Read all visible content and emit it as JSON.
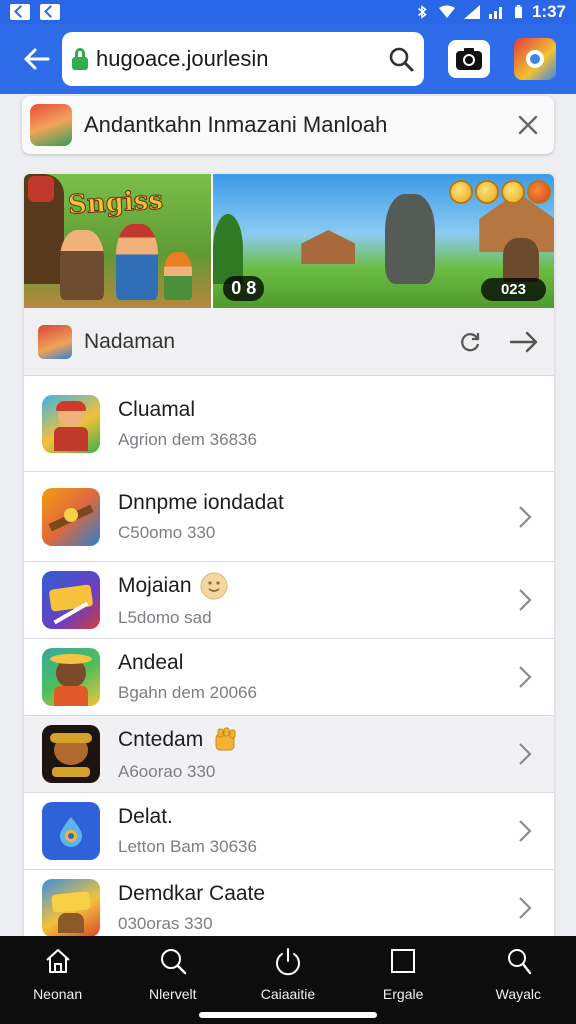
{
  "status_bar": {
    "time": "1:37"
  },
  "address_bar": {
    "url": "hugoace.jourlesin"
  },
  "search_chip": {
    "text": "Andantkahn Inmazani Manloah"
  },
  "banner": {
    "title": "Sngiss",
    "score_left": "0 8",
    "score_right": "023"
  },
  "section": {
    "title": "Nadaman"
  },
  "items": [
    {
      "title": "Cluamal",
      "subtitle": "Agrion dem 36836"
    },
    {
      "title": "Dnnpme iondadat",
      "subtitle": "C50omo 330"
    },
    {
      "title": "Mojaian",
      "subtitle": "L5domo sad"
    },
    {
      "title": "Andeal",
      "subtitle": "Bgahn dem 20066"
    },
    {
      "title": "Cntedam",
      "subtitle": "A6oorao 330"
    },
    {
      "title": "Delat.",
      "subtitle": "Letton Bam 30636"
    },
    {
      "title": "Demdkar Caate",
      "subtitle": "030oras 330"
    }
  ],
  "nav": [
    {
      "label": "Neonan",
      "icon": "home-icon"
    },
    {
      "label": "Nlervelt",
      "icon": "search-icon"
    },
    {
      "label": "Caiaaitie",
      "icon": "power-icon"
    },
    {
      "label": "Ergale",
      "icon": "square-icon"
    },
    {
      "label": "Wayalc",
      "icon": "profile-icon"
    }
  ],
  "colors": {
    "accent": "#2f6cea",
    "nav_bg": "#0d0d0d",
    "lock": "#2fae4e"
  }
}
